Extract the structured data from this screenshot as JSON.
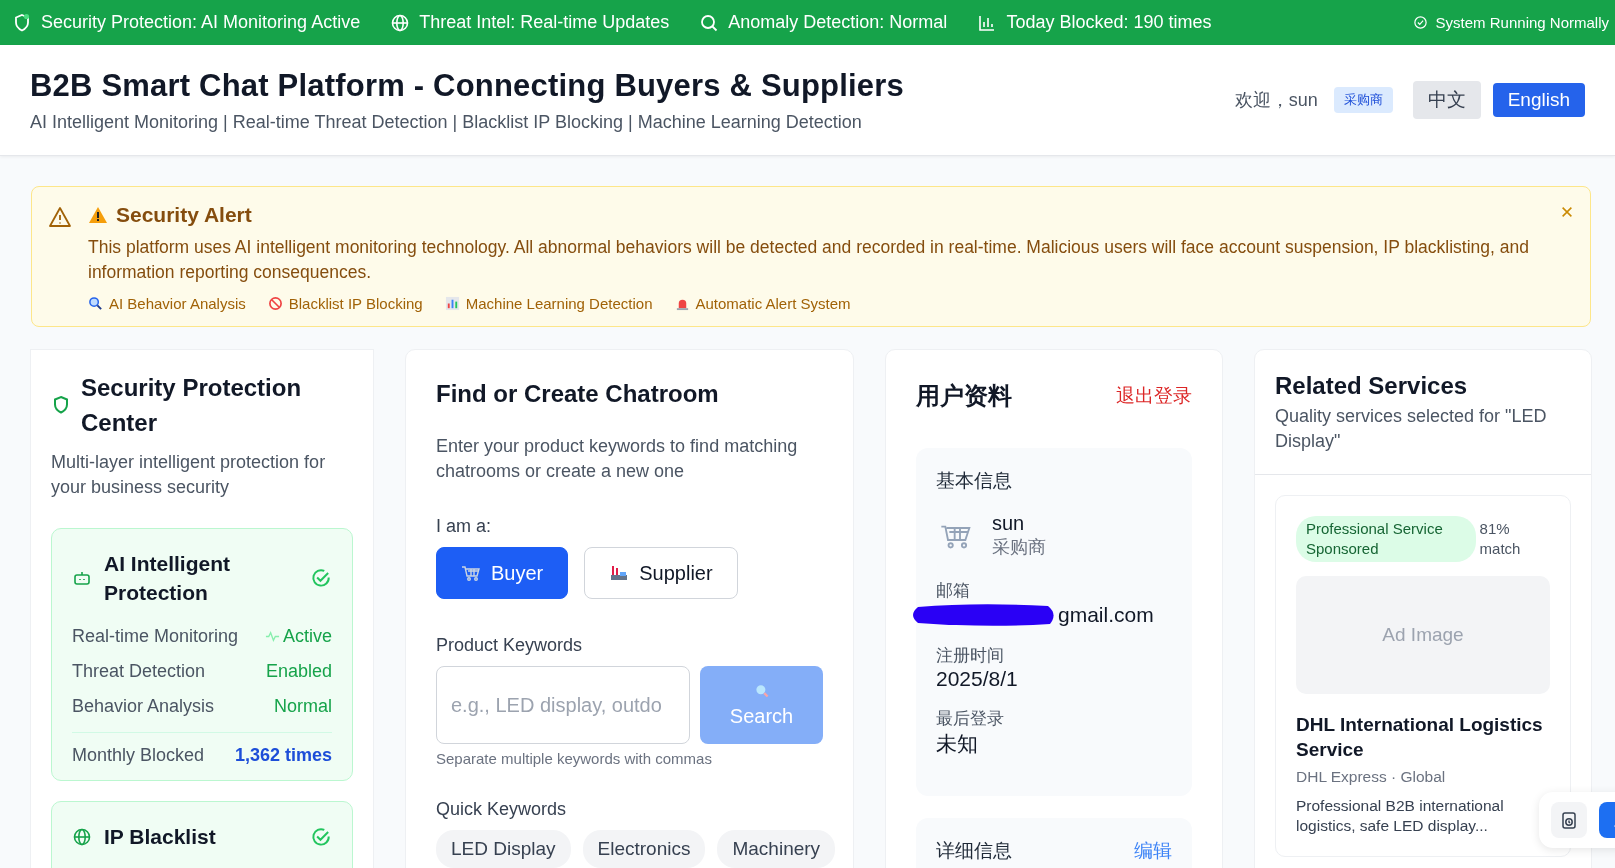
{
  "status_bar": {
    "items": [
      {
        "label": "Security Protection: AI Monitoring Active"
      },
      {
        "label": "Threat Intel: Real-time Updates"
      },
      {
        "label": "Anomaly Detection: Normal"
      },
      {
        "label": "Today Blocked: 190 times"
      }
    ],
    "system": "System Running Normally"
  },
  "header": {
    "title": "B2B Smart Chat Platform - Connecting Buyers & Suppliers",
    "subtitle": "AI Intelligent Monitoring | Real-time Threat Detection | Blacklist IP Blocking | Machine Learning Detection",
    "greeting": "欢迎，sun",
    "role_badge": "采购商",
    "languages": [
      {
        "label": "中文",
        "selected": false
      },
      {
        "label": "English",
        "selected": true
      }
    ]
  },
  "alert": {
    "title": "Security Alert",
    "message": "This platform uses AI intelligent monitoring technology. All abnormal behaviors will be detected and recorded in real-time. Malicious users will face account suspension, IP blacklisting, and information reporting consequences.",
    "features": [
      "AI Behavior Analysis",
      "Blacklist IP Blocking",
      "Machine Learning Detection",
      "Automatic Alert System"
    ]
  },
  "security_center": {
    "title": "Security Protection Center",
    "subtitle": "Multi-layer intelligent protection for your business security",
    "modules": [
      {
        "title": "AI Intelligent Protection",
        "rows": [
          {
            "label": "Real-time Monitoring",
            "value": "Active",
            "kind": "live"
          },
          {
            "label": "Threat Detection",
            "value": "Enabled",
            "kind": "plain"
          },
          {
            "label": "Behavior Analysis",
            "value": "Normal",
            "kind": "plain"
          }
        ],
        "stat_label": "Monthly Blocked",
        "stat_value": "1,362 times"
      },
      {
        "title": "IP Blacklist"
      }
    ]
  },
  "chatroom": {
    "title": "Find or Create Chatroom",
    "description": "Enter your product keywords to find matching chatrooms or create a new one",
    "role_label": "I am a:",
    "roles": [
      {
        "label": "Buyer",
        "selected": true
      },
      {
        "label": "Supplier",
        "selected": false
      }
    ],
    "keywords_label": "Product Keywords",
    "placeholder": "e.g., LED display, outdo",
    "search_button": {
      "label": "Search",
      "disabled": true
    },
    "hint": "Separate multiple keywords with commas",
    "quick_label": "Quick Keywords",
    "quick_keywords": [
      "LED Display",
      "Electronics",
      "Machinery"
    ]
  },
  "profile": {
    "title": "用户资料",
    "logout": "退出登录",
    "basic_title": "基本信息",
    "name": "sun",
    "role": "采购商",
    "fields": [
      {
        "label": "邮箱",
        "value": "gmail.com",
        "redacted": true
      },
      {
        "label": "注册时间",
        "value": "2025/8/1",
        "redacted": false
      },
      {
        "label": "最后登录",
        "value": "未知",
        "redacted": false
      }
    ],
    "details_title": "详细信息",
    "edit": "编辑"
  },
  "related": {
    "title": "Related Services",
    "subtitle": "Quality services selected for \"LED Display\"",
    "services": [
      {
        "badge": "Professional Service Sponsored",
        "match": "81% match",
        "image": "Ad Image",
        "name": "DHL International Logistics Service",
        "provider": "DHL Express · Global",
        "description": "Professional B2B international logistics, safe LED display..."
      }
    ]
  }
}
